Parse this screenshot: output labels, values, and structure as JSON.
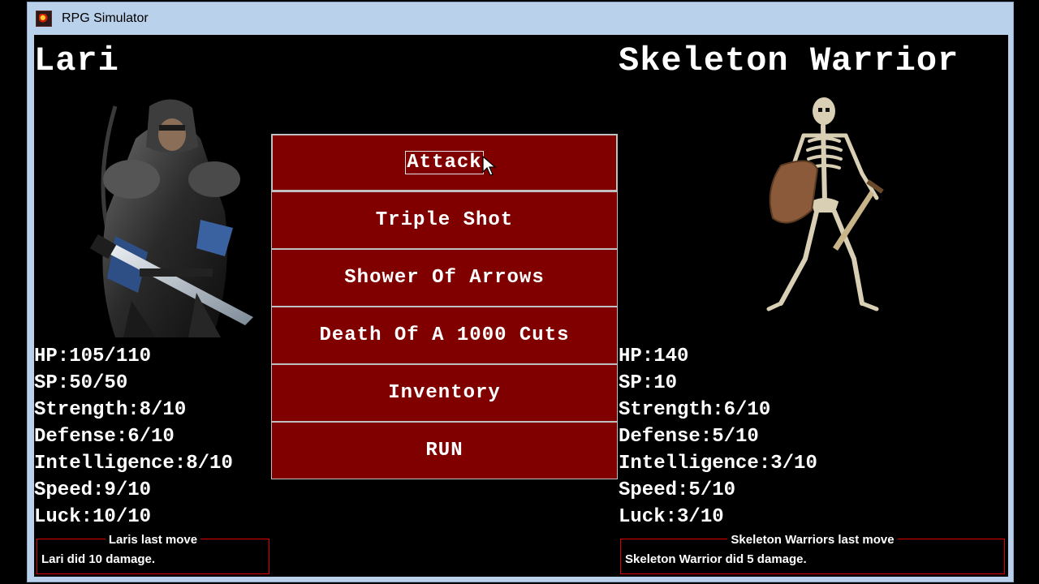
{
  "window": {
    "title": "RPG Simulator"
  },
  "player": {
    "name": "Lari",
    "portrait": "hooded-archer-portrait",
    "stats": [
      "HP:105/110",
      "SP:50/50",
      "Strength:8/10",
      "Defense:6/10",
      "Intelligence:8/10",
      "Speed:9/10",
      "Luck:10/10"
    ],
    "last_move_label": "Laris last move",
    "last_move_text": "Lari did 10 damage."
  },
  "enemy": {
    "name": "Skeleton Warrior",
    "portrait": "skeleton-warrior-portrait",
    "stats": [
      "HP:140",
      "SP:10",
      "Strength:6/10",
      "Defense:5/10",
      "Intelligence:3/10",
      "Speed:5/10",
      "Luck:3/10"
    ],
    "last_move_label": "Skeleton Warriors last move",
    "last_move_text": "Skeleton Warrior did 5 damage."
  },
  "menu": {
    "items": [
      "Attack",
      "Triple Shot",
      "Shower Of Arrows",
      "Death Of A 1000 Cuts",
      "Inventory",
      "RUN"
    ],
    "focused_index": 0
  },
  "colors": {
    "button_bg": "#800000",
    "border_red": "#e00000",
    "window_frame": "#b9d1ea"
  }
}
